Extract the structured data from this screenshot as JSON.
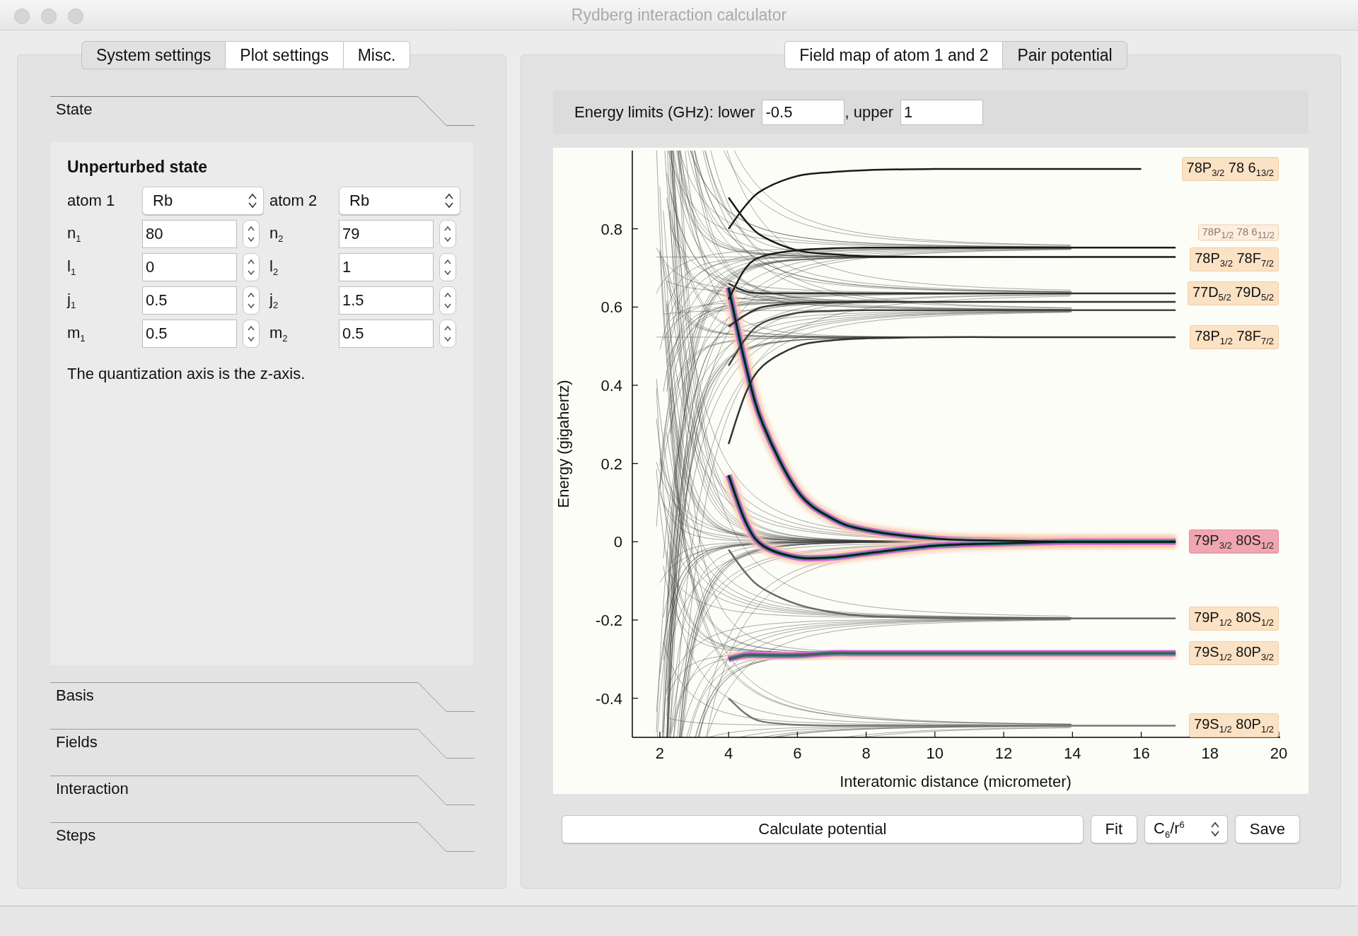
{
  "window": {
    "title": "Rydberg interaction calculator"
  },
  "left_panel": {
    "tabs": [
      {
        "label": "System settings",
        "selected": true
      },
      {
        "label": "Plot settings",
        "selected": false
      },
      {
        "label": "Misc.",
        "selected": false
      }
    ],
    "sections": [
      {
        "title": "State",
        "expanded": true
      },
      {
        "title": "Basis",
        "expanded": false
      },
      {
        "title": "Fields",
        "expanded": false
      },
      {
        "title": "Interaction",
        "expanded": false
      },
      {
        "title": "Steps",
        "expanded": false
      }
    ],
    "state_form": {
      "heading": "Unperturbed state",
      "rows": [
        {
          "kind": "select",
          "fields": [
            {
              "label": "atom 1",
              "value": "Rb"
            },
            {
              "label": "atom 2",
              "value": "Rb"
            }
          ]
        },
        {
          "kind": "spin",
          "fields": [
            {
              "label": "n$_{1}$",
              "value": "80"
            },
            {
              "label": "n$_{2}$",
              "value": "79"
            }
          ]
        },
        {
          "kind": "spin",
          "fields": [
            {
              "label": "l$_{1}$",
              "value": "0"
            },
            {
              "label": "l$_{2}$",
              "value": "1"
            }
          ]
        },
        {
          "kind": "spin",
          "fields": [
            {
              "label": "j$_{1}$",
              "value": "0.5"
            },
            {
              "label": "j$_{2}$",
              "value": "1.5"
            }
          ]
        },
        {
          "kind": "spin",
          "fields": [
            {
              "label": "m$_{1}$",
              "value": "0.5"
            },
            {
              "label": "m$_{2}$",
              "value": "0.5"
            }
          ]
        }
      ],
      "note": "The quantization axis is the z-axis."
    }
  },
  "right_panel": {
    "tabs": [
      {
        "label": "Field map of atom 1 and 2",
        "selected": false
      },
      {
        "label": "Pair potential",
        "selected": true
      }
    ],
    "energy_limits": {
      "label": "Energy limits (GHz): lower",
      "lower": "-0.5",
      "separator": ", upper",
      "upper": "1"
    },
    "plot": {
      "chart_data": {
        "type": "line",
        "xlabel": "Interatomic distance (micrometer)",
        "ylabel": "Energy (gigahertz)",
        "xlim": [
          1.2,
          20
        ],
        "ylim": [
          -0.5,
          1
        ],
        "xticks": [
          2,
          4,
          6,
          8,
          10,
          12,
          14,
          16,
          18,
          20
        ],
        "yticks": [
          -0.4,
          -0.2,
          0,
          0.2,
          0.4,
          0.6,
          0.8
        ],
        "x": [
          4,
          4.5,
          5,
          6,
          7,
          8,
          10,
          12,
          14,
          16,
          17
        ],
        "series": [
          {
            "color": "#1a1a1a",
            "values": [
              0.8,
              0.86,
              0.9,
              0.935,
              0.945,
              0.95,
              0.953,
              0.953,
              0.953,
              0.953,
              null
            ]
          },
          {
            "color": "#1a1a1a",
            "values": [
              0.62,
              0.7,
              0.73,
              0.745,
              0.75,
              0.752,
              0.752,
              0.752,
              0.752,
              0.752,
              0.752
            ]
          },
          {
            "color": "#1a1a1a",
            "values": [
              0.88,
              0.82,
              0.78,
              0.745,
              0.735,
              0.73,
              0.728,
              0.728,
              0.728,
              0.728,
              0.728
            ]
          },
          {
            "color": "#333333",
            "values": [
              0.66,
              0.64,
              0.635,
              0.635,
              0.635,
              0.635,
              0.635,
              0.635,
              0.635,
              0.635,
              0.635
            ]
          },
          {
            "color": "#333333",
            "values": [
              0.55,
              0.58,
              0.6,
              0.61,
              0.612,
              0.613,
              0.613,
              0.613,
              0.613,
              0.613,
              0.613
            ]
          },
          {
            "color": "#444444",
            "values": [
              0.45,
              0.52,
              0.56,
              0.585,
              0.59,
              0.592,
              0.592,
              0.592,
              0.592,
              0.592,
              0.592
            ]
          },
          {
            "color": "#333333",
            "values": [
              0.25,
              0.38,
              0.45,
              0.5,
              0.515,
              0.52,
              0.523,
              0.523,
              0.523,
              0.523,
              0.523
            ]
          },
          {
            "color": "#0a1a14",
            "values": [
              0.65,
              0.45,
              0.3,
              0.13,
              0.06,
              0.03,
              0.008,
              0.003,
              0,
              0,
              0
            ]
          },
          {
            "color": "#0a1a14",
            "values": [
              0.17,
              0.05,
              -0.01,
              -0.04,
              -0.04,
              -0.03,
              -0.01,
              -0.004,
              0,
              0,
              0
            ]
          },
          {
            "color": "#666666",
            "values": [
              -0.02,
              -0.08,
              -0.12,
              -0.16,
              -0.18,
              -0.19,
              -0.195,
              -0.196,
              -0.196,
              -0.196,
              -0.196
            ]
          },
          {
            "color": "#555555",
            "values": [
              -0.3,
              -0.29,
              -0.29,
              -0.29,
              -0.285,
              -0.285,
              -0.285,
              -0.285,
              -0.285,
              -0.285,
              -0.285
            ]
          },
          {
            "color": "#777777",
            "values": [
              -0.4,
              -0.44,
              -0.46,
              -0.468,
              -0.47,
              -0.47,
              -0.47,
              -0.47,
              -0.47,
              -0.47,
              -0.47
            ]
          }
        ]
      },
      "state_labels": [
        {
          "text": "78P$_{3/2}$ 78 6$_{13/2}$",
          "selected": false,
          "dimmed": false
        },
        {
          "text": "78P$_{1/2}$ 78 6$_{11/2}$",
          "selected": false,
          "dimmed": true
        },
        {
          "text": "78P$_{3/2}$ 78F$_{7/2}$",
          "selected": false,
          "dimmed": false
        },
        {
          "text": "77D$_{5/2}$ 79D$_{5/2}$",
          "selected": false,
          "dimmed": false
        },
        {
          "text": "78P$_{1/2}$ 78F$_{7/2}$",
          "selected": false,
          "dimmed": false
        },
        {
          "text": "79P$_{3/2}$ 80S$_{1/2}$",
          "selected": true,
          "dimmed": false
        },
        {
          "text": "79P$_{1/2}$ 80S$_{1/2}$",
          "selected": false,
          "dimmed": false
        },
        {
          "text": "79S$_{1/2}$ 80P$_{3/2}$",
          "selected": false,
          "dimmed": false
        },
        {
          "text": "79S$_{1/2}$ 80P$_{1/2}$",
          "selected": false,
          "dimmed": false
        }
      ]
    },
    "actions": [
      {
        "kind": "wide",
        "label": "Calculate potential"
      },
      {
        "kind": "button",
        "label": "Fit"
      },
      {
        "kind": "select",
        "label": "C$_{6}$/r$^{6}$"
      },
      {
        "kind": "button",
        "label": "Save"
      }
    ]
  }
}
